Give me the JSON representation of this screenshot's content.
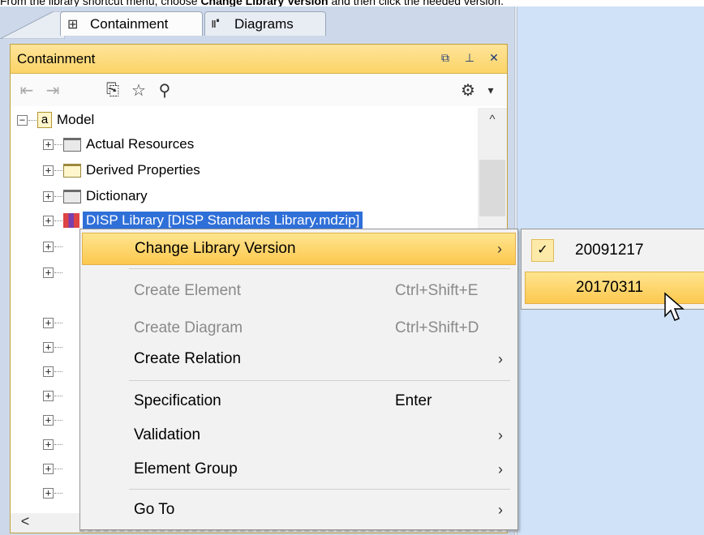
{
  "caption": {
    "pre": "From the library shortcut menu, choose ",
    "bold1": "Change Library Version",
    "post": " and then click the needed version."
  },
  "tabs": {
    "containment": "Containment",
    "diagrams": "Diagrams"
  },
  "panel": {
    "title": "Containment",
    "header_buttons": [
      "restore-icon",
      "pin-icon",
      "close-icon"
    ]
  },
  "toolbar": {
    "icons": [
      "collapse-all-icon",
      "expand-all-icon",
      "open-icon",
      "favorites-star-icon",
      "search-icon",
      "gear-icon",
      "dropdown-icon"
    ]
  },
  "tree": {
    "root": "Model",
    "items": [
      {
        "label": "Actual Resources"
      },
      {
        "label": "Derived Properties"
      },
      {
        "label": "Dictionary"
      },
      {
        "label": "DISP Library [DISP Standards Library.mdzip]"
      }
    ]
  },
  "context_menu": {
    "items": [
      {
        "label": "Change Library Version",
        "shortcut": "",
        "arrow": "›",
        "highlighted": true,
        "disabled": false
      },
      {
        "label": "Create Element",
        "shortcut": "Ctrl+Shift+E",
        "arrow": "",
        "disabled": true
      },
      {
        "label": "Create Diagram",
        "shortcut": "Ctrl+Shift+D",
        "arrow": "",
        "disabled": true
      },
      {
        "label": "Create Relation",
        "shortcut": "",
        "arrow": "›",
        "disabled": false
      },
      {
        "label": "Specification",
        "shortcut": "Enter",
        "arrow": "",
        "disabled": false
      },
      {
        "label": "Validation",
        "shortcut": "",
        "arrow": "›",
        "disabled": false
      },
      {
        "label": "Element Group",
        "shortcut": "",
        "arrow": "›",
        "disabled": false
      },
      {
        "label": "Go To",
        "shortcut": "",
        "arrow": "›",
        "disabled": false
      }
    ]
  },
  "submenu": {
    "items": [
      {
        "label": "20091217",
        "checked": true
      },
      {
        "label": "20170311",
        "checked": false,
        "highlighted": true
      }
    ]
  },
  "colors": {
    "menu_highlight": "#fcc84e",
    "panel_header": "#fbd467",
    "selection": "#2f6fd8",
    "right_area": "#cfe2f7"
  }
}
